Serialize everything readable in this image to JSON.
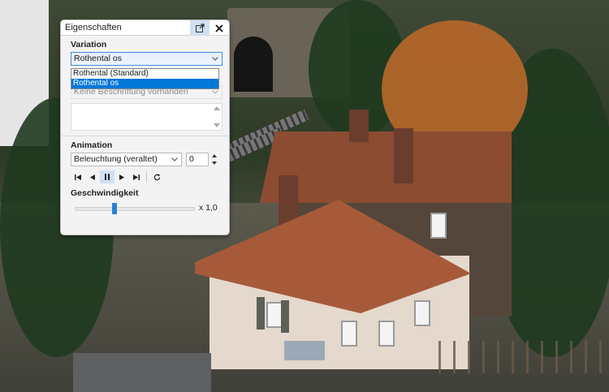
{
  "panel": {
    "title": "Eigenschaften",
    "header_icons": [
      "popout-icon",
      "close-icon"
    ]
  },
  "variation": {
    "label": "Variation",
    "selected": "Rothental os",
    "options": [
      "Rothental (Standard)",
      "Rothental os"
    ],
    "highlighted_option": "Rothental os"
  },
  "labeling": {
    "placeholder_value": "Keine Beschriftung vorhanden"
  },
  "animation": {
    "label": "Animation",
    "selected": "Beleuchtung (veraltet)",
    "number": "0",
    "controls": [
      "skip-start-icon",
      "step-back-icon",
      "pause-icon",
      "play-icon",
      "skip-end-icon",
      "refresh-icon"
    ]
  },
  "speed": {
    "label": "Geschwindigkeit",
    "value_text": "x 1,0",
    "slider_fraction": 0.33
  },
  "colors": {
    "accent": "#0078d7",
    "active_bg": "#cfe1f3"
  }
}
